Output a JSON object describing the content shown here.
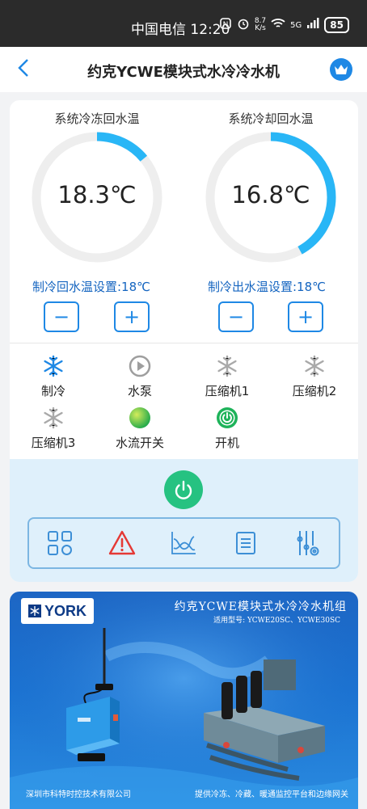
{
  "status_bar": {
    "carrier_time": "中国电信 12:20",
    "speed_value": "8.7",
    "speed_unit": "K/s",
    "network": "5G",
    "battery": "85"
  },
  "header": {
    "title": "约克YCWE模块式水冷冷水机"
  },
  "gauges": [
    {
      "title": "系统冷冻回水温",
      "value": "18.3℃",
      "level": 0.14
    },
    {
      "title": "系统冷却回水温",
      "value": "16.8℃",
      "level": 0.42
    }
  ],
  "setpoints": [
    {
      "label": "制冷回水温设置:18℃",
      "minus": "−",
      "plus": "+"
    },
    {
      "label": "制冷出水温设置:18℃",
      "minus": "−",
      "plus": "+"
    }
  ],
  "statuses": [
    {
      "label": "制冷",
      "icon": "snowflake-icon",
      "state": "active"
    },
    {
      "label": "水泵",
      "icon": "pump-play-icon",
      "state": "inactive"
    },
    {
      "label": "压缩机1",
      "icon": "snowflake-icon",
      "state": "inactive"
    },
    {
      "label": "压缩机2",
      "icon": "snowflake-icon",
      "state": "inactive"
    },
    {
      "label": "压缩机3",
      "icon": "snowflake-icon",
      "state": "inactive"
    },
    {
      "label": "水流开关",
      "icon": "flow-switch-icon",
      "state": "active"
    },
    {
      "label": "开机",
      "icon": "power-icon",
      "state": "active"
    }
  ],
  "toolbar": [
    {
      "icon": "grid-icon"
    },
    {
      "icon": "alarm-icon"
    },
    {
      "icon": "curve-chart-icon"
    },
    {
      "icon": "list-icon"
    },
    {
      "icon": "settings-slider-icon"
    }
  ],
  "banner": {
    "logo": "YORK",
    "title": "约克YCWE模块式水冷冷水机组",
    "models": "适用型号: YCWE20SC、YCWE30SC",
    "company": "深圳市科特时控技术有限公司",
    "slogan": "提供冷冻、冷藏、暖通监控平台和边缘网关"
  },
  "colors": {
    "accent": "#1e88e5",
    "gauge_track": "#eeeeee",
    "gauge_arc": "#29b6f6",
    "power_green": "#26c281",
    "alarm_red": "#e53935"
  }
}
